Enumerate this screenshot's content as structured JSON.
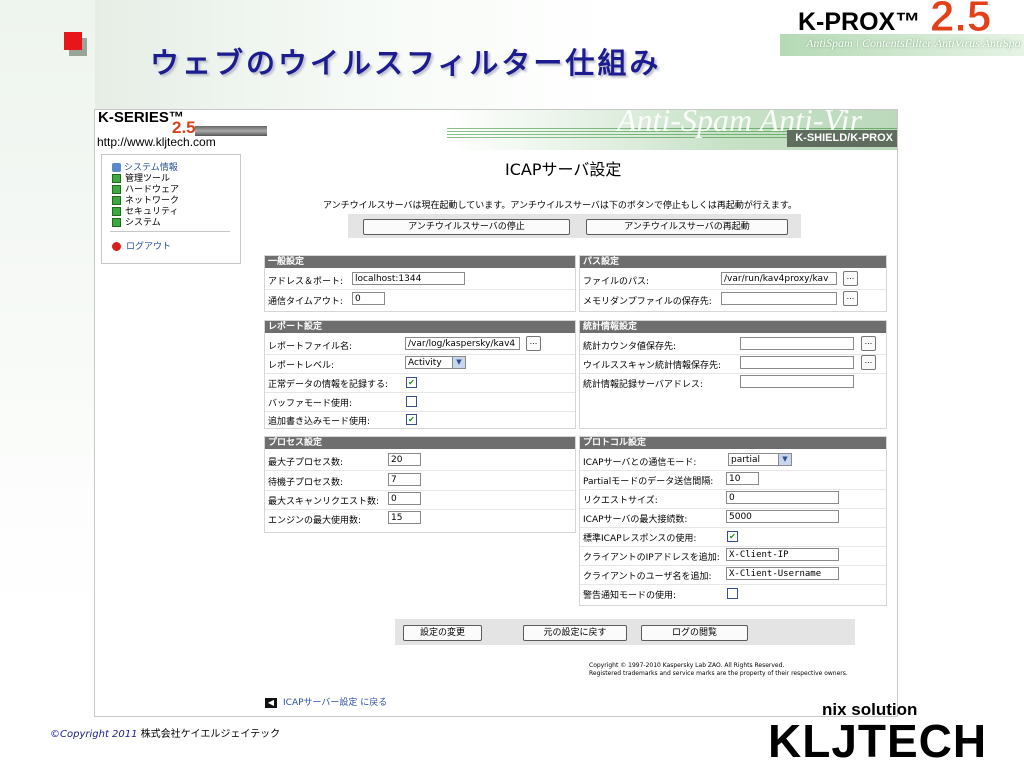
{
  "slide": {
    "title": "ウェブのウイルスフィルター仕組み",
    "logo_product": "K-PROX™",
    "logo_version": "2.5",
    "logo_tagline": "AntiSpam | ContentsFilter   AntiVirus   AntiSpa",
    "footer_copyright": "©Copyright 2011",
    "footer_company": "株式会社ケイエルジェイテック",
    "brand_tagline": "nix solution",
    "brand_name": "KLJTECH"
  },
  "app": {
    "logo_title": "K-SERIES™",
    "logo_version": "2.5",
    "logo_url": "http://www.kljtech.com",
    "banner_product": "K-SHIELD/K-PROX",
    "banner_deco": "Anti-Spam   Anti-Vir"
  },
  "sidebar": {
    "items": [
      {
        "label": "システム情報"
      },
      {
        "label": "管理ツール"
      },
      {
        "label": "ハードウェア"
      },
      {
        "label": "ネットワーク"
      },
      {
        "label": "セキュリティ"
      },
      {
        "label": "システム"
      }
    ],
    "logout": "ログアウト"
  },
  "main": {
    "heading": "ICAPサーバ設定",
    "status": "アンチウイルスサーバは現在起動しています。アンチウイルスサーバは下のボタンで停止もしくは再起動が行えます。",
    "stop_button": "アンチウイルスサーバの停止",
    "restart_button": "アンチウイルスサーバの再起動"
  },
  "general": {
    "header": "一般設定",
    "address_label": "アドレス＆ポート:",
    "address_value": "localhost:1344",
    "timeout_label": "通信タイムアウト:",
    "timeout_value": "0"
  },
  "paths": {
    "header": "パス設定",
    "file_label": "ファイルのパス:",
    "file_value": "/var/run/kav4proxy/kav",
    "dump_label": "メモリダンプファイルの保存先:",
    "dump_value": "",
    "browse": "..."
  },
  "report": {
    "header": "レポート設定",
    "file_label": "レポートファイル名:",
    "file_value": "/var/log/kaspersky/kav4",
    "level_label": "レポートレベル:",
    "level_value": "Activity",
    "normal_label": "正常データの情報を記録する:",
    "normal_checked": true,
    "buffer_label": "バッファモード使用:",
    "buffer_checked": false,
    "append_label": "追加書き込みモード使用:",
    "append_checked": true
  },
  "stats": {
    "header": "統計情報設定",
    "counter_label": "統計カウンタ値保存先:",
    "counter_value": "",
    "scan_label": "ウイルススキャン統計情報保存先:",
    "scan_value": "",
    "server_label": "統計情報記録サーバアドレス:",
    "server_value": ""
  },
  "process": {
    "header": "プロセス設定",
    "max_child_label": "最大子プロセス数:",
    "max_child_value": "20",
    "idle_child_label": "待機子プロセス数:",
    "idle_child_value": "7",
    "max_scan_label": "最大スキャンリクエスト数:",
    "max_scan_value": "0",
    "engine_label": "エンジンの最大使用数:",
    "engine_value": "15"
  },
  "protocol": {
    "header": "プロトコル設定",
    "mode_label": "ICAPサーバとの通信モード:",
    "mode_value": "partial",
    "interval_label": "Partialモードのデータ送信間隔:",
    "interval_value": "10",
    "reqsize_label": "リクエストサイズ:",
    "reqsize_value": "0",
    "maxconn_label": "ICAPサーバの最大接続数:",
    "maxconn_value": "5000",
    "std_label": "標準ICAPレスポンスの使用:",
    "std_checked": true,
    "clientip_label": "クライアントのIPアドレスを追加:",
    "clientip_value": "X-Client-IP",
    "clientuser_label": "クライアントのユーザ名を追加:",
    "clientuser_value": "X-Client-Username",
    "warn_label": "警告通知モードの使用:",
    "warn_checked": false
  },
  "actions": {
    "apply": "設定の変更",
    "revert": "元の設定に戻す",
    "logs": "ログの閲覧"
  },
  "footer": {
    "copyright_line1": "Copyright © 1997-2010 Kaspersky Lab ZAO. All Rights Reserved.",
    "copyright_line2": "Registered trademarks and service marks are the property of their respective owners.",
    "back_link": "ICAPサーバー設定 に戻る"
  },
  "colors": {
    "accent_red": "#e8151b",
    "title_blue": "#1c1c90",
    "panel_header": "#6e6e6e",
    "link_blue": "#2a4fa0"
  }
}
